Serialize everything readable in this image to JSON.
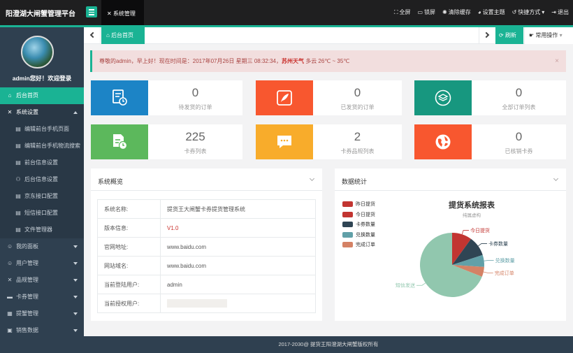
{
  "app": {
    "title": "阳澄湖大闸蟹管理平台",
    "section_tab": "系统管理"
  },
  "topbar": {
    "items": [
      "全屏",
      "锁屏",
      "清除缓存",
      "设置主题",
      "快捷方式",
      "退出"
    ]
  },
  "user": {
    "welcome": "admin您好！欢迎登录"
  },
  "sidebar": {
    "items": [
      {
        "label": "后台首页",
        "icon": "home-icon"
      },
      {
        "label": "系统设置",
        "icon": "wrench-icon"
      },
      {
        "label": "编辑前台手机页面",
        "icon": "list-icon"
      },
      {
        "label": "编辑前台手机物流搜索",
        "icon": "list-icon"
      },
      {
        "label": "前台信息设置",
        "icon": "list-icon"
      },
      {
        "label": "后台信息设置",
        "icon": "users-icon"
      },
      {
        "label": "京东接口配置",
        "icon": "list-icon"
      },
      {
        "label": "短信接口配置",
        "icon": "list-icon"
      },
      {
        "label": "文件管理器",
        "icon": "list-icon"
      },
      {
        "label": "我的面板",
        "icon": "user-icon"
      },
      {
        "label": "用户管理",
        "icon": "user-icon"
      },
      {
        "label": "品规管理",
        "icon": "wrench-icon"
      },
      {
        "label": "卡券管理",
        "icon": "card-icon"
      },
      {
        "label": "提蟹管理",
        "icon": "grid-icon"
      },
      {
        "label": "销售数据",
        "icon": "chart-icon"
      }
    ]
  },
  "tabs": {
    "home": "后台首页",
    "refresh": "刷新",
    "common": "常用操作"
  },
  "alert": {
    "text": "尊敬的admin，早上好！现在时间是：2017年07月26日 星期三 08:32:34，",
    "weather_label": "苏州天气",
    "weather_value": " 多云 26℃ ~ 35℃",
    "close": "×"
  },
  "stats": [
    {
      "value": "0",
      "label": "待发货的订单",
      "color": "#1c84c6",
      "icon": "order-list-icon"
    },
    {
      "value": "0",
      "label": "已发货的订单",
      "color": "#f8572f",
      "icon": "quill-icon"
    },
    {
      "value": "0",
      "label": "全部订单列表",
      "color": "#17977f",
      "icon": "layers-icon"
    },
    {
      "value": "225",
      "label": "卡券列表",
      "color": "#5cb85c",
      "icon": "card-time-icon"
    },
    {
      "value": "2",
      "label": "卡券品规列表",
      "color": "#f8ac2b",
      "icon": "chat-icon"
    },
    {
      "value": "0",
      "label": "已核销卡券",
      "color": "#f8572f",
      "icon": "globe-icon"
    }
  ],
  "overview": {
    "title": "系统概览",
    "rows": [
      {
        "key": "系统名称:",
        "value": "提货王大闸蟹卡券提货管理系统"
      },
      {
        "key": "版本信息:",
        "value": "V1.0"
      },
      {
        "key": "官网地址:",
        "value": "www.baidu.com"
      },
      {
        "key": "网站域名:",
        "value": "www.baidu.com"
      },
      {
        "key": "当前登陆用户:",
        "value": "admin"
      },
      {
        "key": "当前授权用户:",
        "value": ""
      }
    ]
  },
  "stats_panel": {
    "title": "数据统计"
  },
  "chart_data": {
    "type": "pie",
    "title": "提货系统报表",
    "subtitle": "纯属虚构",
    "legend_position": "top-left",
    "slices": [
      {
        "name": "昨日提货",
        "value": 0,
        "color": "#c23531"
      },
      {
        "name": "今日提货",
        "value": 10,
        "color": "#c23531"
      },
      {
        "name": "卡券数量",
        "value": 10,
        "color": "#2f4554"
      },
      {
        "name": "兑换数量",
        "value": 6,
        "color": "#61a0a8"
      },
      {
        "name": "完成订单",
        "value": 5,
        "color": "#d48265"
      },
      {
        "name": "短信发送",
        "value": 69,
        "color": "#91c7ae"
      }
    ],
    "legend": [
      "昨日提货",
      "今日提货",
      "卡券数量",
      "兑换数量",
      "完成订单"
    ]
  },
  "footer": {
    "text": "2017-2030@ 提货王阳澄湖大闸蟹版权所有"
  }
}
